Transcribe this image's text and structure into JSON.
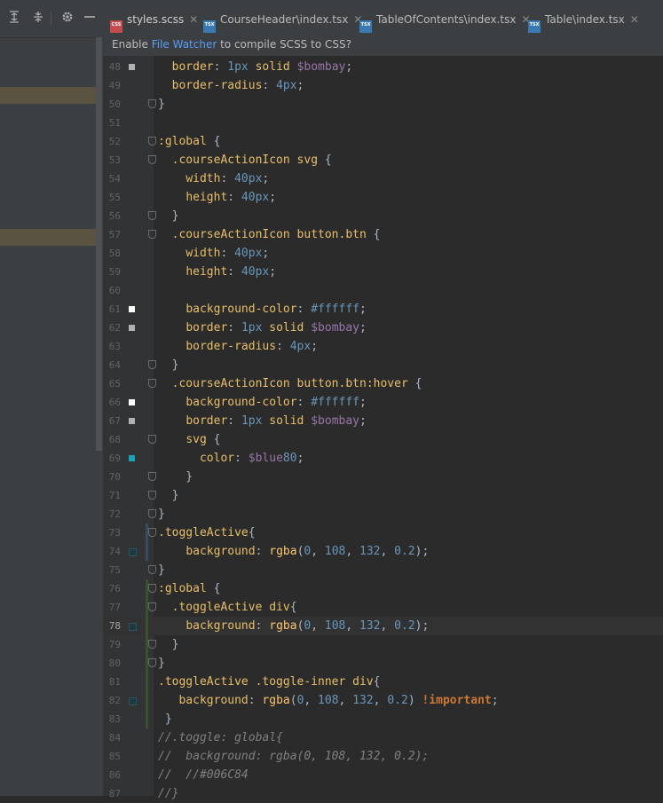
{
  "left_toolbar": {
    "icons": [
      "expand-all-icon",
      "collapse-all-icon",
      "gear-icon",
      "minimize-icon"
    ]
  },
  "tabs": [
    {
      "label": "styles.scss",
      "type": "scss",
      "active": true
    },
    {
      "label": "CourseHeader\\index.tsx",
      "type": "tsx",
      "active": false
    },
    {
      "label": "TableOfContents\\index.tsx",
      "type": "tsx",
      "active": false
    },
    {
      "label": "Table\\index.tsx",
      "type": "tsx",
      "active": false
    }
  ],
  "notification": {
    "prefix": "Enable ",
    "link": "File Watcher",
    "suffix": " to compile SCSS to CSS?"
  },
  "colors": {
    "accent": "#4a88c7",
    "swatch_white": "#ffffff",
    "swatch_bombay": "#afb1b3",
    "swatch_blue80": "#1aa3b8",
    "vcs_modified": "#384c5c",
    "vcs_added": "#3b4f33"
  },
  "editor": {
    "current_line": 78,
    "lines": [
      {
        "n": "48",
        "code": "  border: 1px solid $bombay;",
        "swatch": "bombay"
      },
      {
        "n": "49",
        "code": "  border-radius: 4px;"
      },
      {
        "n": "50",
        "code": "}"
      },
      {
        "n": "51",
        "code": ""
      },
      {
        "n": "52",
        "code": ":global {"
      },
      {
        "n": "53",
        "code": "  .courseActionIcon svg {"
      },
      {
        "n": "54",
        "code": "    width: 40px;"
      },
      {
        "n": "55",
        "code": "    height: 40px;"
      },
      {
        "n": "56",
        "code": "  }"
      },
      {
        "n": "57",
        "code": "  .courseActionIcon button.btn {"
      },
      {
        "n": "58",
        "code": "    width: 40px;"
      },
      {
        "n": "59",
        "code": "    height: 40px;"
      },
      {
        "n": "60",
        "code": ""
      },
      {
        "n": "61",
        "code": "    background-color: #ffffff;",
        "swatch": "white"
      },
      {
        "n": "62",
        "code": "    border: 1px solid $bombay;",
        "swatch": "bombay"
      },
      {
        "n": "63",
        "code": "    border-radius: 4px;"
      },
      {
        "n": "64",
        "code": "  }"
      },
      {
        "n": "65",
        "code": "  .courseActionIcon button.btn:hover {"
      },
      {
        "n": "66",
        "code": "    background-color: #ffffff;",
        "swatch": "white"
      },
      {
        "n": "67",
        "code": "    border: 1px solid $bombay;",
        "swatch": "bombay"
      },
      {
        "n": "68",
        "code": "    svg {"
      },
      {
        "n": "69",
        "code": "      color: $blue80;",
        "swatch": "blue80"
      },
      {
        "n": "70",
        "code": "    }"
      },
      {
        "n": "71",
        "code": "  }"
      },
      {
        "n": "72",
        "code": "}"
      },
      {
        "n": "73",
        "code": ".toggleActive{"
      },
      {
        "n": "74",
        "code": "    background: rgba(0, 108, 132, 0.2);",
        "swatch": "teal"
      },
      {
        "n": "75",
        "code": "}"
      },
      {
        "n": "76",
        "code": ":global {"
      },
      {
        "n": "77",
        "code": "  .toggleActive div{"
      },
      {
        "n": "78",
        "code": "    background: rgba(0, 108, 132, 0.2);",
        "swatch": "teal"
      },
      {
        "n": "79",
        "code": "  }"
      },
      {
        "n": "80",
        "code": "}"
      },
      {
        "n": "81",
        "code": ".toggleActive .toggle-inner div{"
      },
      {
        "n": "82",
        "code": "   background: rgba(0, 108, 132, 0.2) !important;",
        "swatch": "teal"
      },
      {
        "n": "83",
        "code": " }"
      },
      {
        "n": "84",
        "code": "//.toggle: global{"
      },
      {
        "n": "85",
        "code": "//  background: rgba(0, 108, 132, 0.2);"
      },
      {
        "n": "86",
        "code": "//  //#006C84"
      },
      {
        "n": "87",
        "code": "//}"
      }
    ]
  }
}
